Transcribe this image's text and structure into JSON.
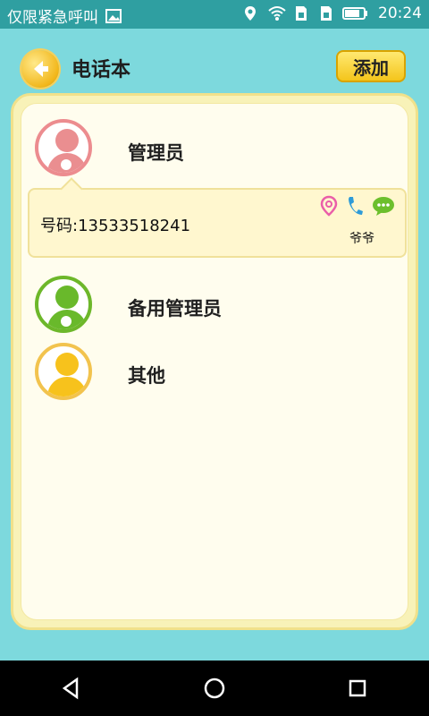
{
  "status_bar": {
    "left_text": "仅限紧急呼叫",
    "time": "20:24",
    "icons": [
      "image-icon",
      "location-icon",
      "wifi-icon",
      "sim1-icon",
      "sim2-icon",
      "battery-icon"
    ]
  },
  "header": {
    "title": "电话本",
    "add_label": "添加"
  },
  "groups": [
    {
      "label": "管理员",
      "avatar_color": "#ea8e90",
      "ring_color": "#ec8c8f"
    },
    {
      "label": "备用管理员",
      "avatar_color": "#69b92b",
      "ring_color": "#6db72a"
    },
    {
      "label": "其他",
      "avatar_color": "#f7c21c",
      "ring_color": "#f2c34e"
    }
  ],
  "contact": {
    "phone": "号码:13533518241",
    "name": "爷爷",
    "actions": [
      "location-pin-icon",
      "phone-icon",
      "message-icon"
    ]
  },
  "colors": {
    "background": "#7dd9dd",
    "status_bar": "#2f9fa1",
    "panel": "#fffdee",
    "button_yellow": "#f4c51b"
  }
}
